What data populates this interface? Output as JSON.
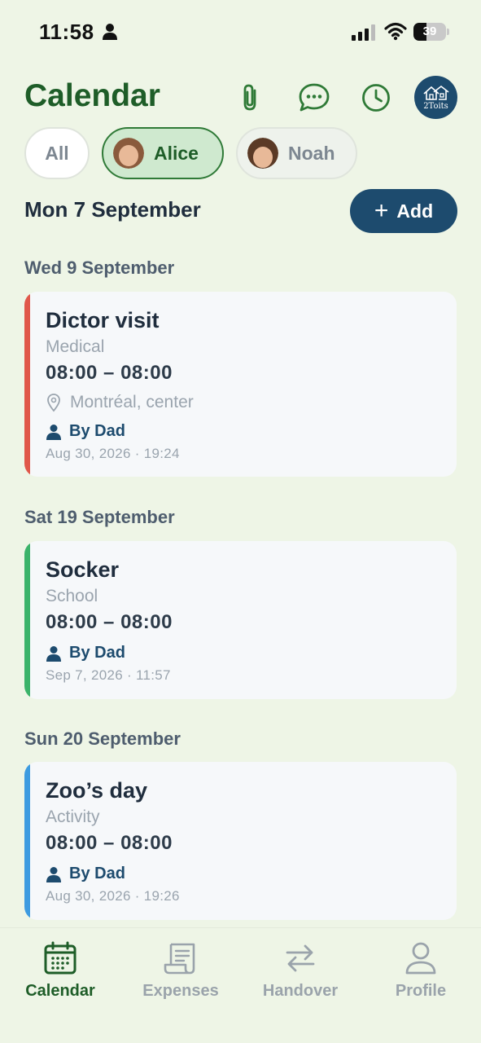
{
  "status_bar": {
    "time": "11:58",
    "battery_level": "39",
    "battery_fraction": 0.39
  },
  "header": {
    "title": "Calendar",
    "icons": [
      "paperclip-icon",
      "chat-bubble-icon",
      "clock-icon",
      "app-logo-avatar"
    ],
    "logo_text": "2Toits"
  },
  "filters": {
    "all_label": "All",
    "children": [
      {
        "name": "Alice",
        "selected": true
      },
      {
        "name": "Noah",
        "selected": false
      }
    ]
  },
  "week": {
    "heading": "Mon 7 September",
    "add_label": "Add"
  },
  "days": [
    {
      "heading": "Wed 9 September",
      "events": [
        {
          "title": "Dictor visit",
          "category": "Medical",
          "time": "08:00 – 08:00",
          "location": "Montréal, center",
          "by": "By Dad",
          "stamp": "Aug 30, 2026 · 19:24",
          "color": "#e0574a"
        }
      ]
    },
    {
      "heading": "Sat 19 September",
      "events": [
        {
          "title": "Socker",
          "category": "School",
          "time": "08:00 – 08:00",
          "by": "By Dad",
          "stamp": "Sep 7, 2026 · 11:57",
          "color": "#3bb36a"
        }
      ]
    },
    {
      "heading": "Sun 20 September",
      "events": [
        {
          "title": "Zoo’s day",
          "category": "Activity",
          "time": "08:00 – 08:00",
          "by": "By Dad",
          "stamp": "Aug 30, 2026 · 19:26",
          "color": "#3d9be0"
        }
      ]
    }
  ],
  "tabbar": {
    "tabs": [
      {
        "label": "Calendar",
        "icon": "calendar-icon",
        "active": true
      },
      {
        "label": "Expenses",
        "icon": "receipt-icon",
        "active": false
      },
      {
        "label": "Handover",
        "icon": "swap-arrows-icon",
        "active": false
      },
      {
        "label": "Profile",
        "icon": "person-icon",
        "active": false
      }
    ]
  },
  "colors": {
    "background": "#eef5e6",
    "brand_green": "#1e5d28",
    "brand_navy": "#1d4b6e"
  }
}
